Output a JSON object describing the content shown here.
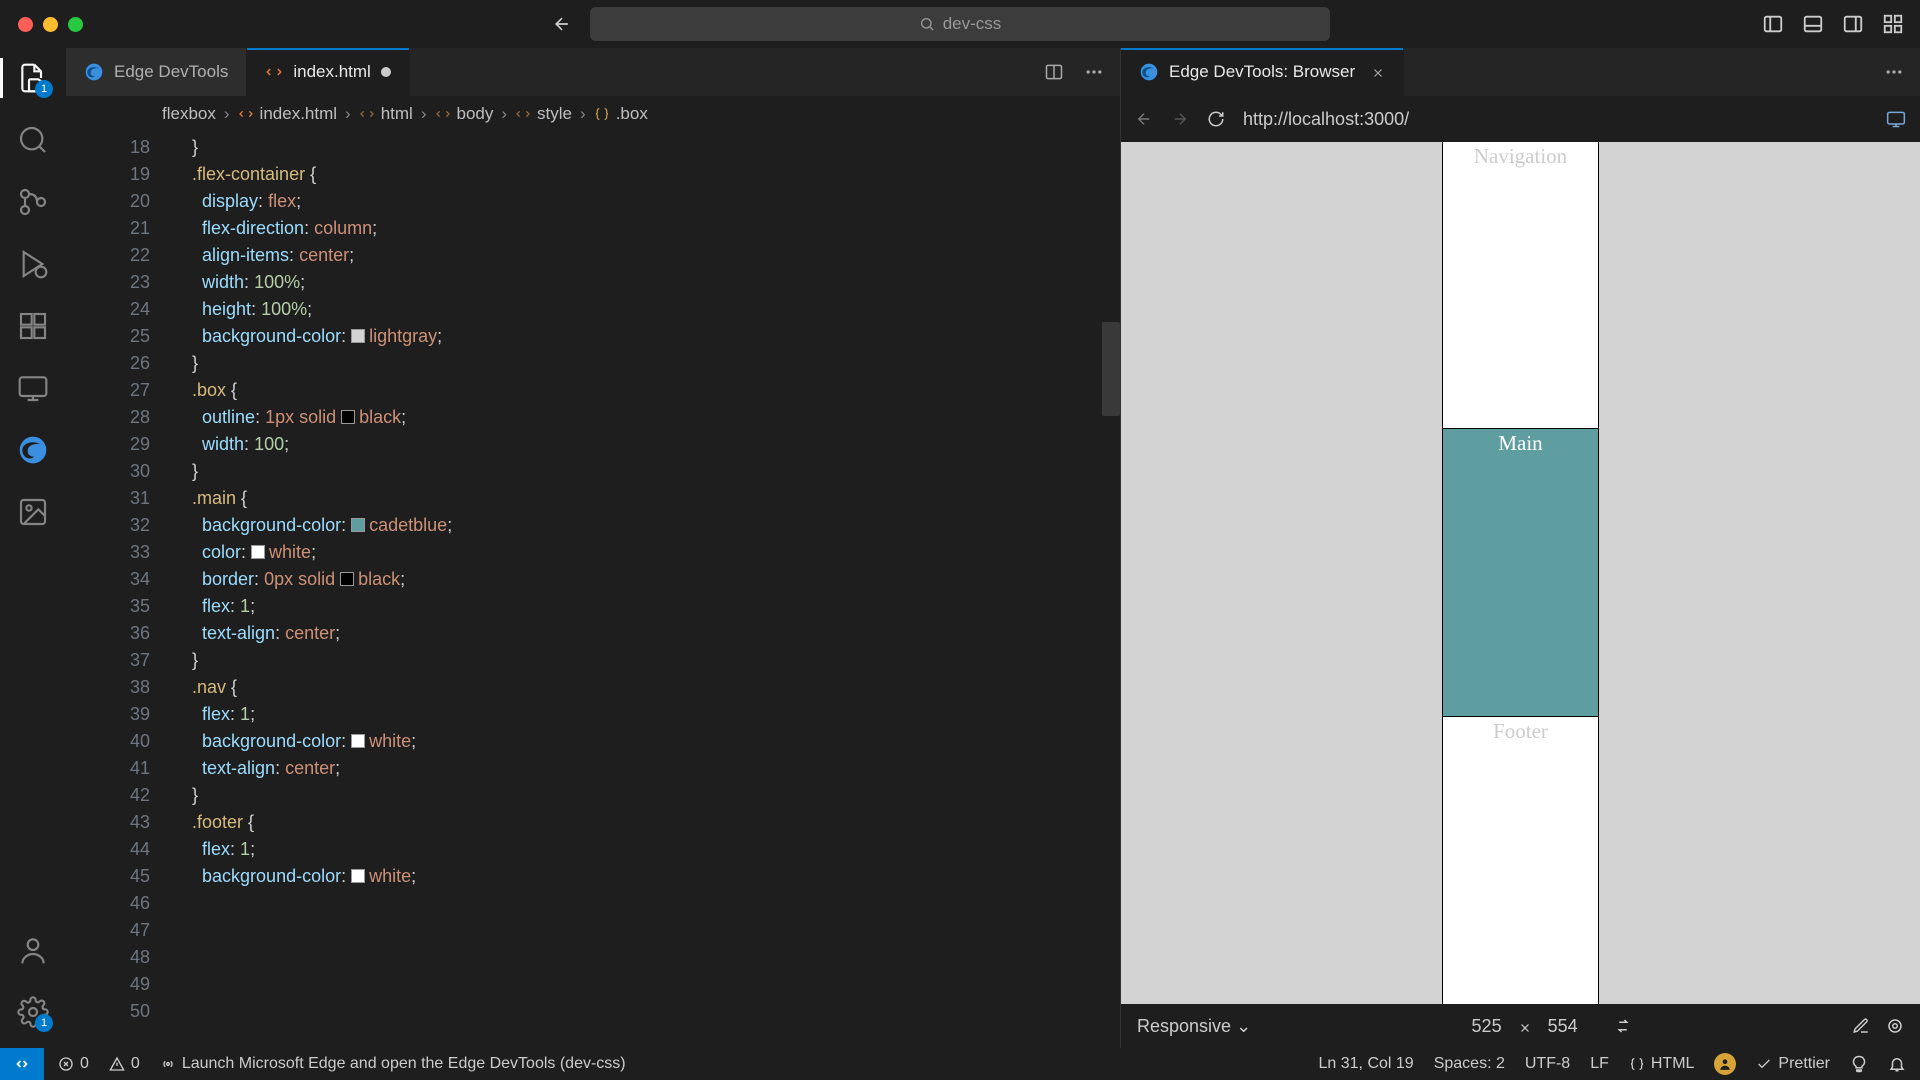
{
  "titlebar": {
    "search": "dev-css"
  },
  "tabs": {
    "t1": {
      "label": "Edge DevTools"
    },
    "t2": {
      "label": "index.html",
      "dirty": true
    },
    "devtools": {
      "label": "Edge DevTools: Browser"
    }
  },
  "breadcrumb": {
    "c0": "flexbox",
    "c1": "index.html",
    "c2": "html",
    "c3": "body",
    "c4": "style",
    "c5": ".box"
  },
  "code": {
    "first_line": 18,
    "lines": [
      {
        "n": 18,
        "raw": "    }"
      },
      {
        "n": 19,
        "raw": ""
      },
      {
        "n": 20,
        "sel": ".flex-container",
        "after": " {"
      },
      {
        "n": 21,
        "prop": "display",
        "val": "flex"
      },
      {
        "n": 22,
        "prop": "flex-direction",
        "val": "column"
      },
      {
        "n": 23,
        "prop": "align-items",
        "val": "center"
      },
      {
        "n": 24,
        "prop": "width",
        "num": "100%"
      },
      {
        "n": 25,
        "prop": "height",
        "num": "100%"
      },
      {
        "n": 26,
        "prop": "background-color",
        "color": "#d3d3d3",
        "val": "lightgray"
      },
      {
        "n": 27,
        "raw": "    }"
      },
      {
        "n": 28,
        "raw": ""
      },
      {
        "n": 29,
        "sel": ".box",
        "after": " {"
      },
      {
        "n": 30,
        "prop": "outline",
        "mixed": "1px solid",
        "color": "#000000",
        "val": "black"
      },
      {
        "n": 31,
        "prop": "width",
        "num": "100"
      },
      {
        "n": 32,
        "raw": "    }"
      },
      {
        "n": 33,
        "raw": ""
      },
      {
        "n": 34,
        "sel": ".main",
        "after": " {"
      },
      {
        "n": 35,
        "prop": "background-color",
        "color": "#5f9ea0",
        "val": "cadetblue"
      },
      {
        "n": 36,
        "prop": "color",
        "color": "#ffffff",
        "val": "white"
      },
      {
        "n": 37,
        "prop": "border",
        "mixed": "0px solid",
        "color": "#000000",
        "val": "black"
      },
      {
        "n": 38,
        "prop": "flex",
        "num": "1"
      },
      {
        "n": 39,
        "prop": "text-align",
        "val": "center"
      },
      {
        "n": 40,
        "raw": "    }"
      },
      {
        "n": 41,
        "raw": ""
      },
      {
        "n": 42,
        "sel": ".nav",
        "after": " {"
      },
      {
        "n": 43,
        "prop": "flex",
        "num": "1"
      },
      {
        "n": 44,
        "prop": "background-color",
        "color": "#ffffff",
        "val": "white"
      },
      {
        "n": 45,
        "prop": "text-align",
        "val": "center"
      },
      {
        "n": 46,
        "raw": "    }"
      },
      {
        "n": 47,
        "raw": ""
      },
      {
        "n": 48,
        "sel": ".footer",
        "after": " {"
      },
      {
        "n": 49,
        "prop": "flex",
        "num": "1"
      },
      {
        "n": 50,
        "prop": "background-color",
        "color": "#ffffff",
        "val": "white"
      }
    ]
  },
  "devtools": {
    "url": "http://localhost:3000/",
    "preview": {
      "nav": "Navigation",
      "main": "Main",
      "footer": "Footer"
    },
    "footer": {
      "mode": "Responsive",
      "w": "525",
      "h": "554"
    }
  },
  "statusbar": {
    "errors": "0",
    "warnings": "0",
    "launch": "Launch Microsoft Edge and open the Edge DevTools (dev-css)",
    "cursor": "Ln 31, Col 19",
    "spaces": "Spaces: 2",
    "encoding": "UTF-8",
    "eol": "LF",
    "lang": "HTML",
    "prettier": "Prettier"
  },
  "activity": {
    "explorer_badge": "1",
    "settings_badge": "1"
  }
}
